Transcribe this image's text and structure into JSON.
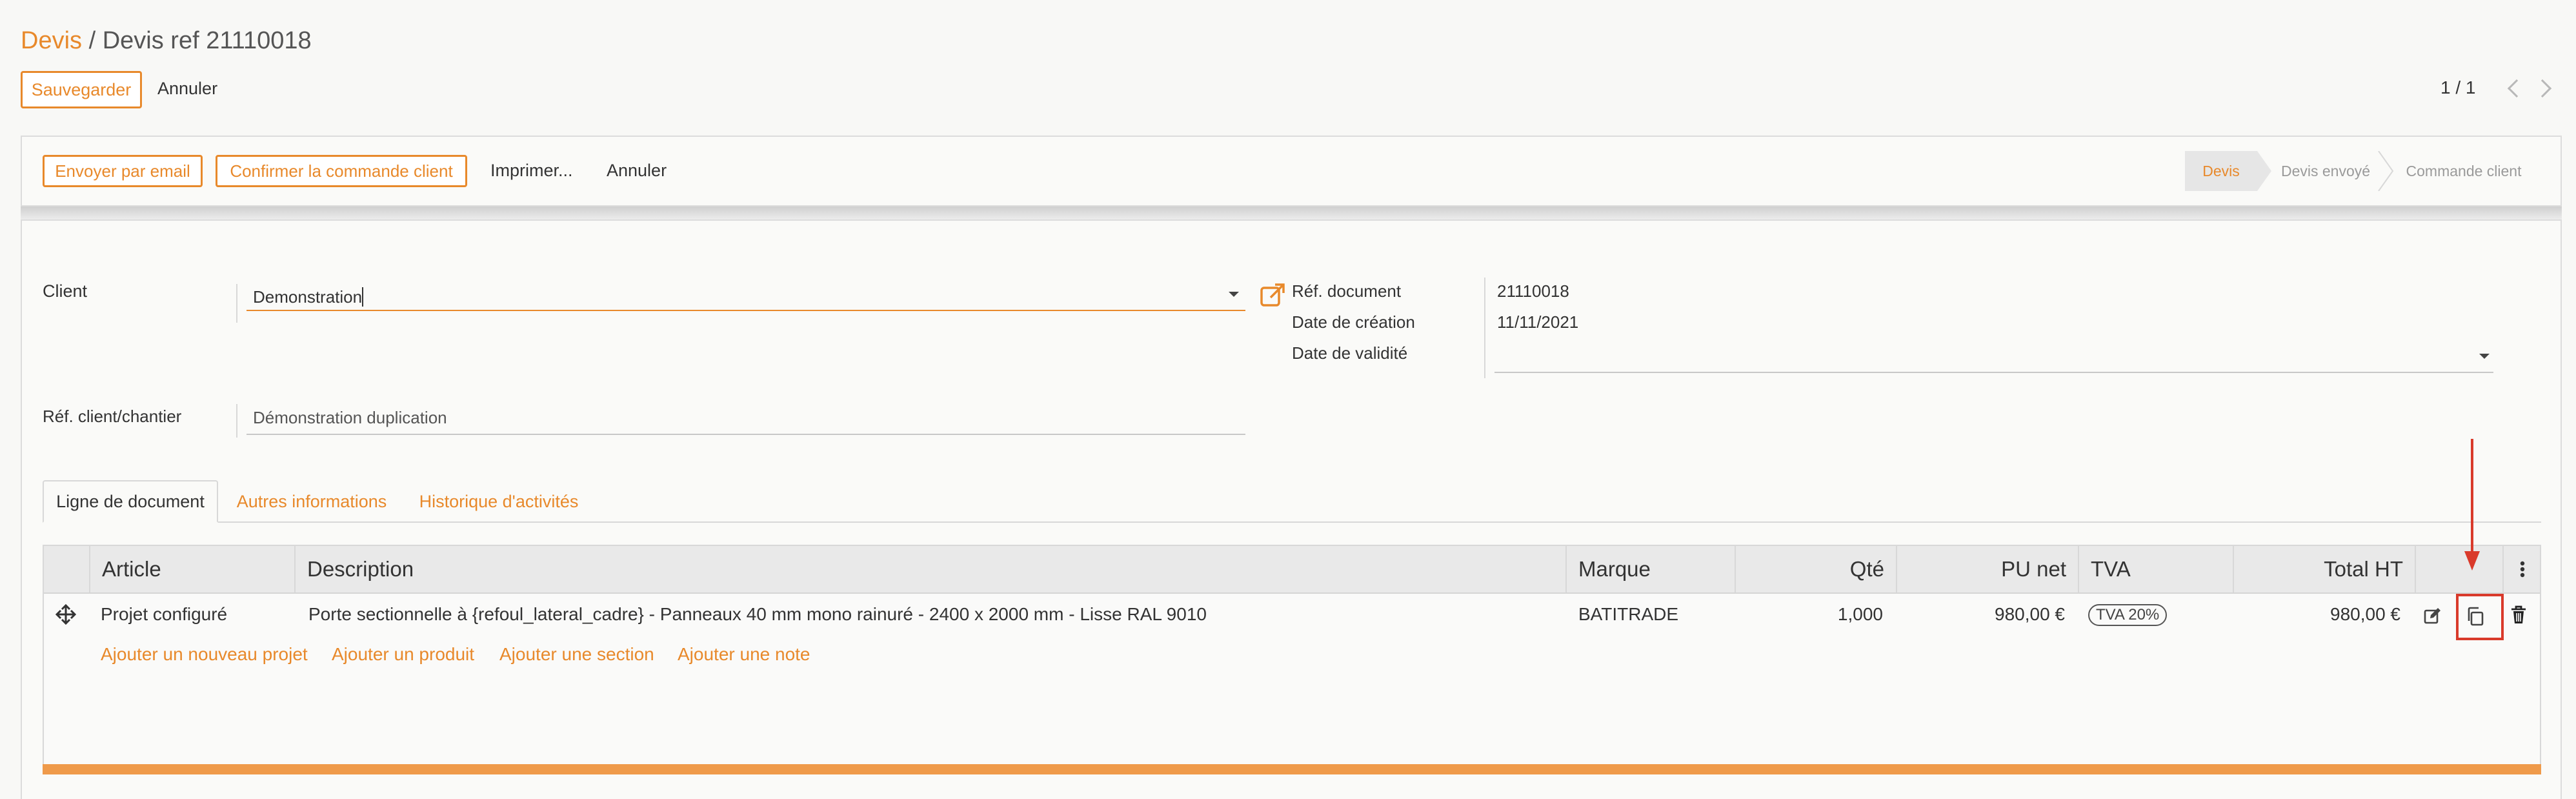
{
  "breadcrumb": {
    "root": "Devis",
    "separator": " / ",
    "current": "Devis ref 21110018"
  },
  "controls": {
    "save_label": "Sauvegarder",
    "discard_label": "Annuler"
  },
  "pager": {
    "value": "1 / 1"
  },
  "actions": {
    "send_email": "Envoyer par email",
    "confirm_order": "Confirmer la commande client",
    "print": "Imprimer...",
    "cancel": "Annuler"
  },
  "status": {
    "steps": [
      "Devis",
      "Devis envoyé",
      "Commande client"
    ],
    "active_index": 0
  },
  "form": {
    "client_label": "Client",
    "client_value": "Demonstration",
    "ref_client_label": "Réf. client/chantier",
    "ref_client_value": "Démonstration duplication",
    "ref_doc_label": "Réf. document",
    "ref_doc_value": "21110018",
    "date_creation_label": "Date de création",
    "date_creation_value": "11/11/2021",
    "date_validite_label": "Date de validité",
    "date_validite_value": ""
  },
  "tabs": [
    "Ligne de document",
    "Autres informations",
    "Historique d'activités"
  ],
  "table": {
    "columns": [
      "Article",
      "Description",
      "Marque",
      "Qté",
      "PU net",
      "TVA",
      "Total HT"
    ],
    "rows": [
      {
        "article": "Projet configuré",
        "description": "Porte sectionnelle à {refoul_lateral_cadre} - Panneaux 40 mm mono rainuré - 2400 x 2000 mm - Lisse RAL 9010",
        "marque": "BATITRADE",
        "qte": "1,000",
        "pu_net": "980,00 €",
        "tva": "TVA 20%",
        "total_ht": "980,00 €"
      }
    ],
    "add_links": [
      "Ajouter un nouveau projet",
      "Ajouter un produit",
      "Ajouter une section",
      "Ajouter une note"
    ]
  },
  "colors": {
    "accent": "#e8892b",
    "highlight": "#d93a2b"
  }
}
